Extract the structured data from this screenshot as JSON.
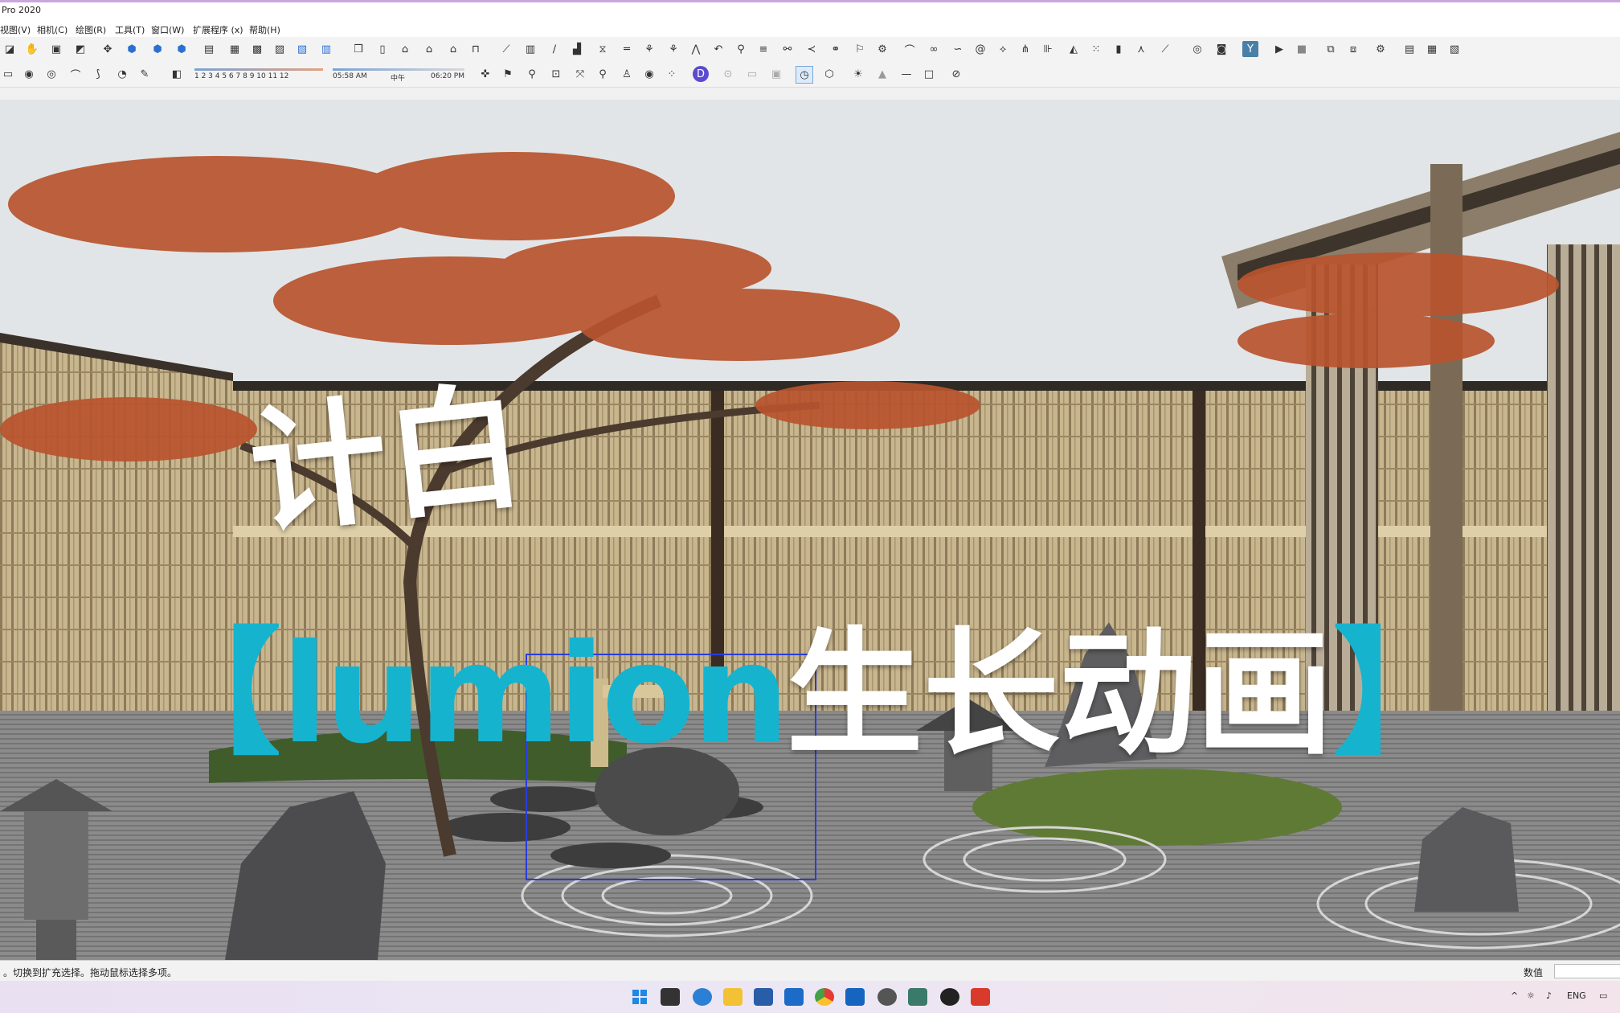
{
  "app": {
    "title": "Pro 2020"
  },
  "menu": [
    {
      "label": "视图(V)"
    },
    {
      "label": "相机(C)"
    },
    {
      "label": "绘图(R)"
    },
    {
      "label": "工具(T)"
    },
    {
      "label": "窗口(W)"
    },
    {
      "label": "扩展程序 (x)"
    },
    {
      "label": "帮助(H)"
    }
  ],
  "shadow_bar": {
    "months": "1 2 3 4 5 6 7 8 9 10 11 12",
    "time_start": "05:58 AM",
    "time_mid": "中午",
    "time_end": "06:20 PM"
  },
  "overlay": {
    "line1": "计白",
    "bracket_open": "【",
    "brand": "lumion",
    "subtitle": "生长动画",
    "bracket_close": "】"
  },
  "status": {
    "hint": "。切换到扩充选择。拖动鼠标选择多项。",
    "measure_label": "数值"
  },
  "tray": {
    "lang": "ENG"
  },
  "colors": {
    "accent_cyan": "#16b3cf",
    "maple": "#b8542e",
    "bamboo": "#c7b491"
  }
}
